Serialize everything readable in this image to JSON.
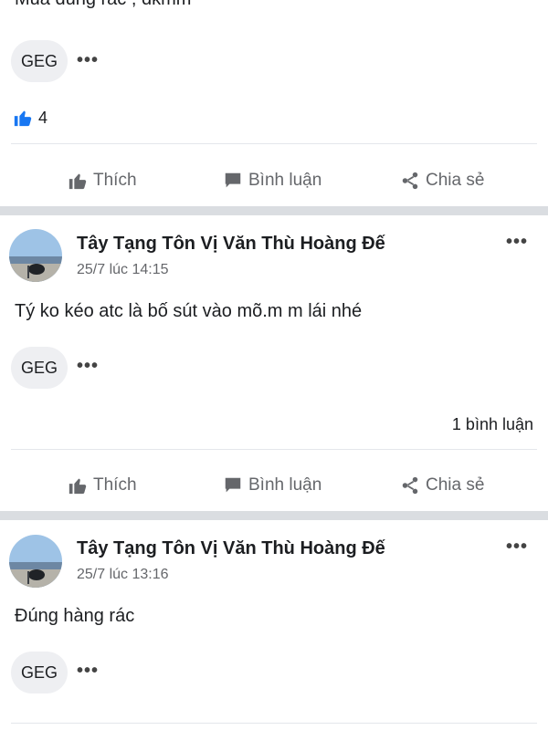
{
  "top_comment": {
    "text": "Mua đúng rác , đkmm",
    "tag": "GEG",
    "more": "•••",
    "like_count": "4"
  },
  "actions": {
    "like": "Thích",
    "comment": "Bình luận",
    "share": "Chia sẻ"
  },
  "posts": [
    {
      "author": "Tây Tạng Tôn Vị Văn Thù Hoàng Đế",
      "time": "25/7 lúc 14:15",
      "text": "Tý ko kéo atc là bố sút vào mõ.m m lái nhé",
      "tag": "GEG",
      "more": "•••",
      "menu": "•••",
      "comments": "1 bình luận"
    },
    {
      "author": "Tây Tạng Tôn Vị Văn Thù Hoàng Đế",
      "time": "25/7 lúc 13:16",
      "text": "Đúng hàng rác",
      "tag": "GEG",
      "more": "•••",
      "menu": "•••"
    }
  ],
  "colors": {
    "like_blue": "#1877f2",
    "divider": "#dadde1",
    "muted": "#65676b"
  }
}
